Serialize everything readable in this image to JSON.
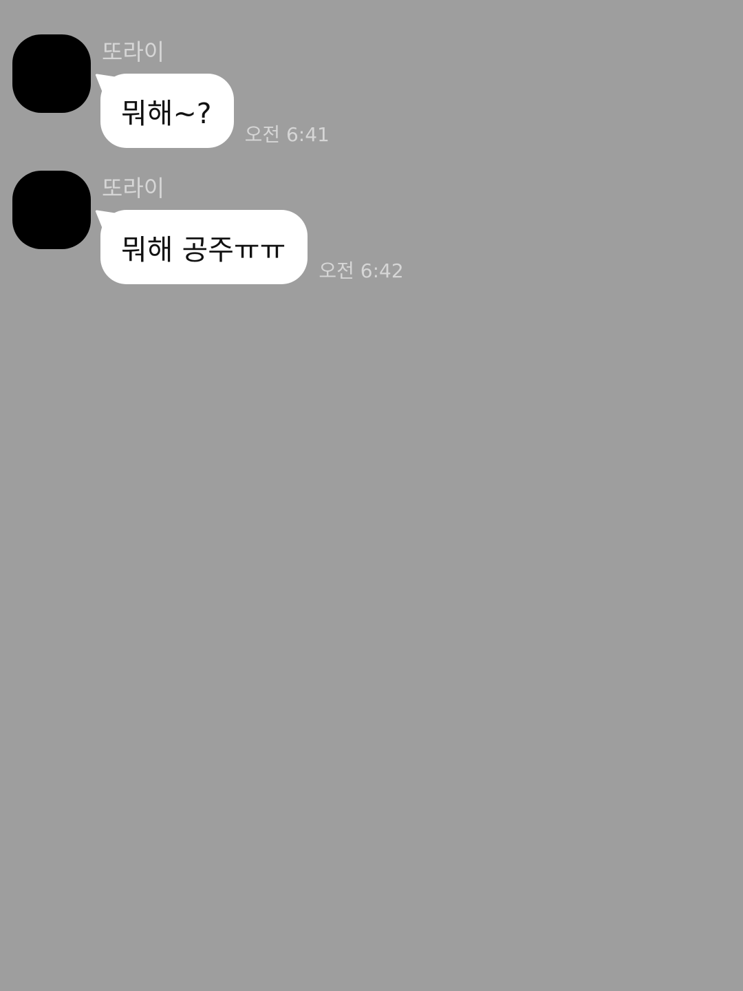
{
  "messages": [
    {
      "sender": "또라이",
      "text": "뭐해~?",
      "time": "오전 6:41"
    },
    {
      "sender": "또라이",
      "text": "뭐해 공주ㅠㅠ",
      "time": "오전 6:42"
    }
  ],
  "colors": {
    "background": "#9e9e9e",
    "bubble": "#ffffff",
    "meta_text": "#d6d6d6",
    "avatar": "#000000"
  }
}
